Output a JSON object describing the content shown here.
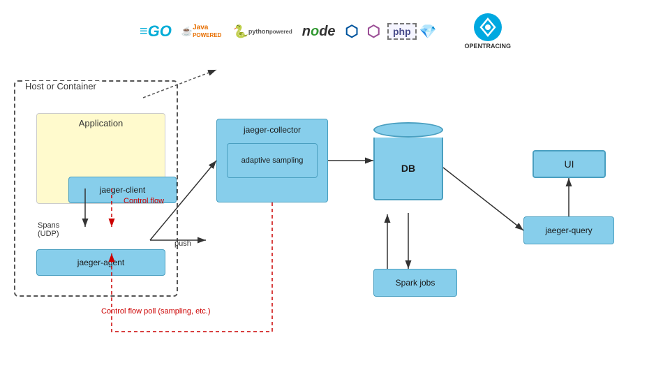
{
  "logos": {
    "go": "≡GO",
    "java": "☕ Java",
    "python": "python",
    "node": "node",
    "cpp": "C++",
    "csharp": "C#",
    "php": "php",
    "ruby": "●",
    "opentracing": "OPENTRACING"
  },
  "diagram": {
    "host_label": "Host or Container",
    "application_label": "Application",
    "jaeger_client_label": "jaeger-client",
    "jaeger_agent_label": "jaeger-agent",
    "spans_label": "Spans\n(UDP)",
    "control_flow_label": "Control flow",
    "jaeger_collector_label": "jaeger-collector",
    "adaptive_sampling_label": "adaptive\nsampling",
    "db_label": "DB",
    "spark_jobs_label": "Spark jobs",
    "jaeger_query_label": "jaeger-query",
    "ui_label": "UI",
    "push_label": "push",
    "control_flow_poll_label": "Control flow poll\n(sampling, etc.)"
  }
}
